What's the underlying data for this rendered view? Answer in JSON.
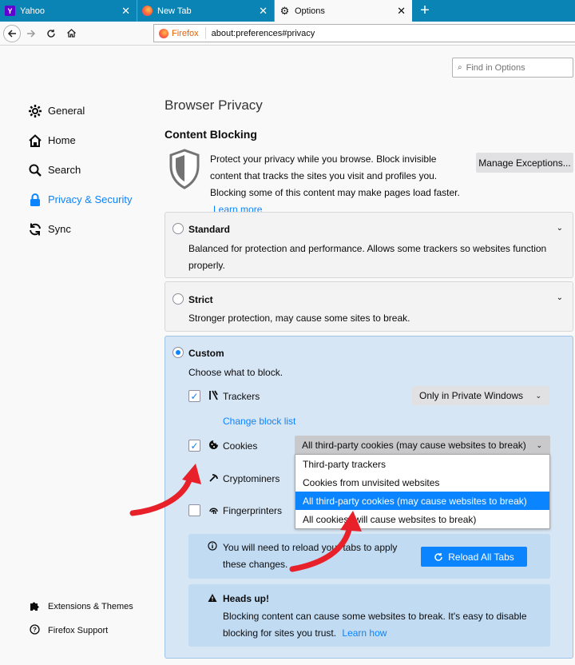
{
  "tabs": [
    {
      "title": "Yahoo",
      "favicon": "yahoo-favicon"
    },
    {
      "title": "New Tab",
      "favicon": "firefox-favicon"
    },
    {
      "title": "Options",
      "favicon": "gear-icon"
    }
  ],
  "newtab": "+",
  "navbar": {
    "identity": "Firefox",
    "url": "about:preferences#privacy"
  },
  "search": {
    "placeholder": "Find in Options"
  },
  "sidebar": {
    "items": [
      {
        "label": "General",
        "icon": "gear-icon"
      },
      {
        "label": "Home",
        "icon": "home-icon"
      },
      {
        "label": "Search",
        "icon": "search-icon"
      },
      {
        "label": "Privacy & Security",
        "icon": "lock-icon",
        "active": true
      },
      {
        "label": "Sync",
        "icon": "sync-icon"
      }
    ],
    "footer": [
      {
        "label": "Extensions & Themes",
        "icon": "puzzle-icon"
      },
      {
        "label": "Firefox Support",
        "icon": "help-icon"
      }
    ]
  },
  "main": {
    "title": "Browser Privacy",
    "section": "Content Blocking",
    "description": "Protect your privacy while you browse. Block invisible content that tracks the sites you visit and profiles you. Blocking some of this content may make pages load faster.",
    "learn_more": "Learn more",
    "manage_exceptions": "Manage Exceptions...",
    "standard": {
      "title": "Standard",
      "text": "Balanced for protection and performance. Allows some trackers so websites function properly."
    },
    "strict": {
      "title": "Strict",
      "text": "Stronger protection, may cause some sites to break."
    },
    "custom": {
      "title": "Custom",
      "subtitle": "Choose what to block.",
      "trackers": {
        "label": "Trackers",
        "select": "Only in Private Windows",
        "checked": true
      },
      "change_block_list": "Change block list",
      "cookies": {
        "label": "Cookies",
        "select": "All third-party cookies (may cause websites to break)",
        "checked": true
      },
      "cryptominers": {
        "label": "Cryptominers",
        "checked": false
      },
      "fingerprinters": {
        "label": "Fingerprinters",
        "checked": false
      },
      "cookie_options": [
        "Third-party trackers",
        "Cookies from unvisited websites",
        "All third-party cookies (may cause websites to break)",
        "All cookies (will cause websites to break)"
      ],
      "reload_notice": "You will need to reload your tabs to apply these changes.",
      "reload_button": "Reload All Tabs",
      "heads_up_title": "Heads up!",
      "heads_up_text": "Blocking content can cause some websites to break. It's easy to disable blocking for sites you trust.",
      "learn_how": "Learn how"
    }
  },
  "colors": {
    "accent": "#0a84ff",
    "tabbar": "#0a84b5",
    "annotation_arrow": "#e8202a"
  }
}
